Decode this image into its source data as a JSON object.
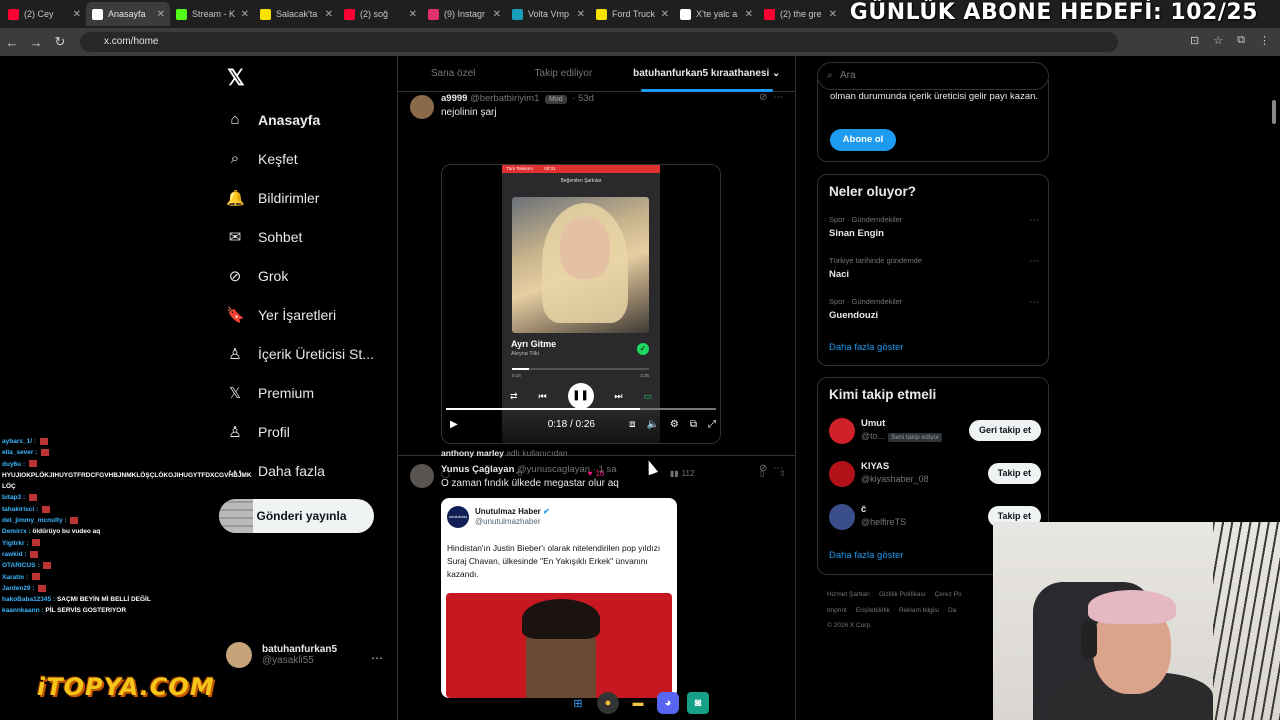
{
  "browser": {
    "tabs": [
      {
        "label": "(2) Cey",
        "color": "#ff0033"
      },
      {
        "label": "Anasayfa",
        "color": "#ffffff",
        "active": true
      },
      {
        "label": "Stream - K",
        "color": "#53fc18"
      },
      {
        "label": "Salacak'ta",
        "color": "#f9e200"
      },
      {
        "label": "(2) soğ",
        "color": "#ff0033"
      },
      {
        "label": "(9) Instagr",
        "color": "#e1306c"
      },
      {
        "label": "Volta Vmp",
        "color": "#19a0b8"
      },
      {
        "label": "Ford Truck",
        "color": "#f9e200"
      },
      {
        "label": "X'te yalc a",
        "color": "#ffffff"
      },
      {
        "label": "(2) the gre",
        "color": "#ff0033"
      }
    ],
    "url": "x.com/home"
  },
  "overlay": {
    "goal": "GÜNLÜK ABONE HEDEFİ: 102/25",
    "watermark": "iTOPYA.COM"
  },
  "sidebar": {
    "logo": "𝕏",
    "items": [
      {
        "label": "Anasayfa",
        "icon": "home-icon",
        "glyph": "⌂"
      },
      {
        "label": "Keşfet",
        "icon": "search-icon",
        "glyph": "⌕"
      },
      {
        "label": "Bildirimler",
        "icon": "bell-icon",
        "glyph": "🔔"
      },
      {
        "label": "Sohbet",
        "icon": "mail-icon",
        "glyph": "✉"
      },
      {
        "label": "Grok",
        "icon": "grok-icon",
        "glyph": "⊘"
      },
      {
        "label": "Yer İşaretleri",
        "icon": "bookmark-icon",
        "glyph": "🔖"
      },
      {
        "label": "İçerik Üreticisi St...",
        "icon": "creator-icon",
        "glyph": "♙"
      },
      {
        "label": "Premium",
        "icon": "x-premium-icon",
        "glyph": "𝕏"
      },
      {
        "label": "Profil",
        "icon": "person-icon",
        "glyph": "♙"
      },
      {
        "label": "Daha fazla",
        "icon": "more-circle-icon",
        "glyph": "⋯"
      }
    ],
    "post_button": "Gönderi yayınla",
    "account": {
      "name": "batuhanfurkan5",
      "handle": "@yasakli55"
    }
  },
  "chat": [
    {
      "user": "aybars_1/ :",
      "msg": ""
    },
    {
      "user": "ella_sever :",
      "msg": ""
    },
    {
      "user": "duy6u :",
      "msg": ""
    },
    {
      "user": "",
      "msg": "HYUJIOKPLÖKJIHUYGTFRDCFGVHBJNMKLÖŞÇLÖKOJIHUGYTFDXCGVHBJMK LÖÇ"
    },
    {
      "user": "bitap3 :",
      "msg": ""
    },
    {
      "user": "tahakirisci :",
      "msg": ""
    },
    {
      "user": "det_jimmy_mcnulty :",
      "msg": ""
    },
    {
      "user": "Demirrx :",
      "msg": "öldürüyo bu vudeo aq"
    },
    {
      "user": "Yigitrkr :",
      "msg": ""
    },
    {
      "user": "rawkid :",
      "msg": ""
    },
    {
      "user": "OTARICUS :",
      "msg": ""
    },
    {
      "user": "Xaratm :",
      "msg": ""
    },
    {
      "user": "Jarden29 :",
      "msg": ""
    },
    {
      "user": "hakoBaba12345 :",
      "msg": "SAÇMI BEYİN Mİ BELLİ DEĞİL"
    },
    {
      "user": "kaannkaann :",
      "msg": "PİL SERVİS GOSTERIYOR"
    }
  ],
  "timeline": {
    "tabs": [
      "Sana özel",
      "Takip ediliyor",
      "batuhanfurkan5 kıraathanesi"
    ],
    "tweet1": {
      "name": "a9999",
      "handle": "@berbatbiriyim1",
      "badge": "Mod",
      "time": "53d",
      "text": "nejolinin şarj",
      "phone": {
        "carrier": "Türk Telekom",
        "clock": "00:31",
        "header": "Beğenilen Şarkılar",
        "song": "Ayrı Gitme",
        "artist": "Aleyna Tilki",
        "elapsed": "0:18",
        "remaining": "2:35"
      },
      "video_time": "0:18 / 0:26",
      "video_progress": 0.72,
      "tagline_user": "anthony marley",
      "tagline_rest": "adlı kullanıcıdan",
      "likes": "16",
      "views": "112"
    },
    "tweet2": {
      "name": "Yunus Çağlayan",
      "handle": "@yunuscaglayan",
      "time": "1 sa",
      "text": "O zaman fındık ülkede megastar olur aq",
      "quote": {
        "name": "Unutulmaz Haber",
        "handle": "@unutulmazhaber",
        "logo": "unutulmaz",
        "text": "Hindistan'ın Justin Bieber'ı olarak nitelendirilen pop yıldızı Suraj Chavan, ülkesinde \"En Yakışıklı Erkek\" ünvanını kazandı."
      }
    }
  },
  "right": {
    "search_placeholder": "Ara",
    "premium_text": "olman durumunda içerik üreticisi gelir payı kazan.",
    "subscribe": "Abone ol",
    "trends_title": "Neler oluyor?",
    "trends": [
      {
        "context": "Spor · Gündemdekiler",
        "name": "Sinan Engin"
      },
      {
        "context": "Türkiye tarihinde gündemde",
        "name": "Naci"
      },
      {
        "context": "Spor · Gündemdekiler",
        "name": "Guendouzi"
      }
    ],
    "show_more": "Daha fazla göster",
    "follow_title": "Kimi takip etmeli",
    "suggestions": [
      {
        "name": "Umut",
        "handle": "@to...",
        "badge": "Seni takip ediyor",
        "button": "Geri takip et",
        "color": "#d0202a"
      },
      {
        "name": "KIYAS",
        "handle": "@kiyashaber_08",
        "badge": "",
        "button": "Takip et",
        "color": "#b3121b"
      },
      {
        "name": "ĉ",
        "handle": "@helfireTS",
        "badge": "",
        "button": "Takip et",
        "color": "#3a4f8a"
      }
    ],
    "footer": [
      "Hizmet Şartları",
      "Gizlilik Politikası",
      "Çerez Po",
      "Imprint",
      "Erişilebilirlik",
      "Reklam bilgisi",
      "Da",
      "© 2026 X Corp."
    ]
  },
  "colors": {
    "accent": "#1d9bf0",
    "like": "#f91880",
    "spotify": "#1ed760"
  }
}
